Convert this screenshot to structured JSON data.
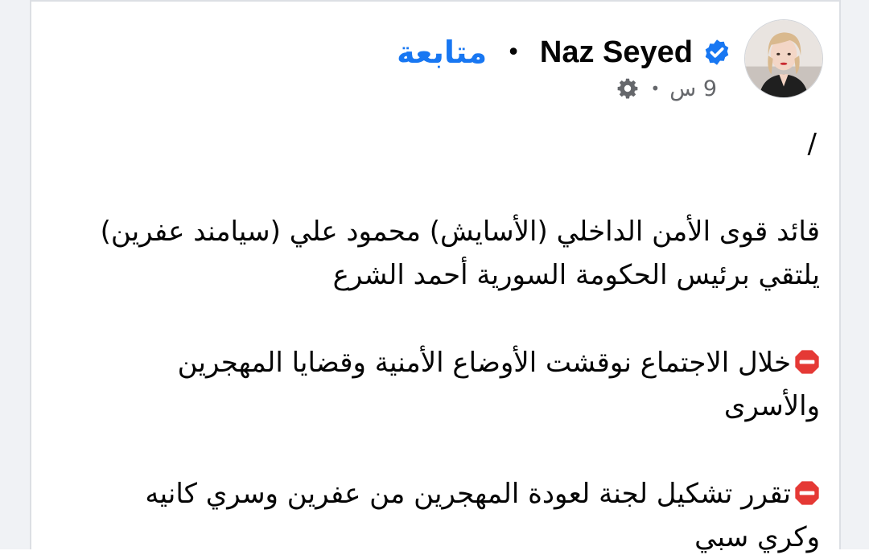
{
  "post": {
    "author": "Naz Seyed",
    "follow_label": "متابعة",
    "separator": "•",
    "time": "9 س",
    "meta_separator": "•",
    "slash_line": "/",
    "paragraph1": "قائد قوى الأمن الداخلي (الأسايش) محمود علي (سيامند عفرين) يلتقي برئيس الحكومة السورية  أحمد الشرع",
    "paragraph2": "خلال الاجتماع نوقشت الأوضاع الأمنية وقضايا المهجرين والأسرى",
    "paragraph3": "تقرر تشكيل لجنة لعودة المهجرين من عفرين وسري كانيه وكري سبي"
  },
  "colors": {
    "accent": "#1877f2",
    "text": "#050505",
    "meta": "#65676b",
    "stop_sign": "#e53935"
  },
  "icons": {
    "verified": "verified-badge-icon",
    "privacy": "gear-icon",
    "bullet": "stop-sign-icon"
  }
}
